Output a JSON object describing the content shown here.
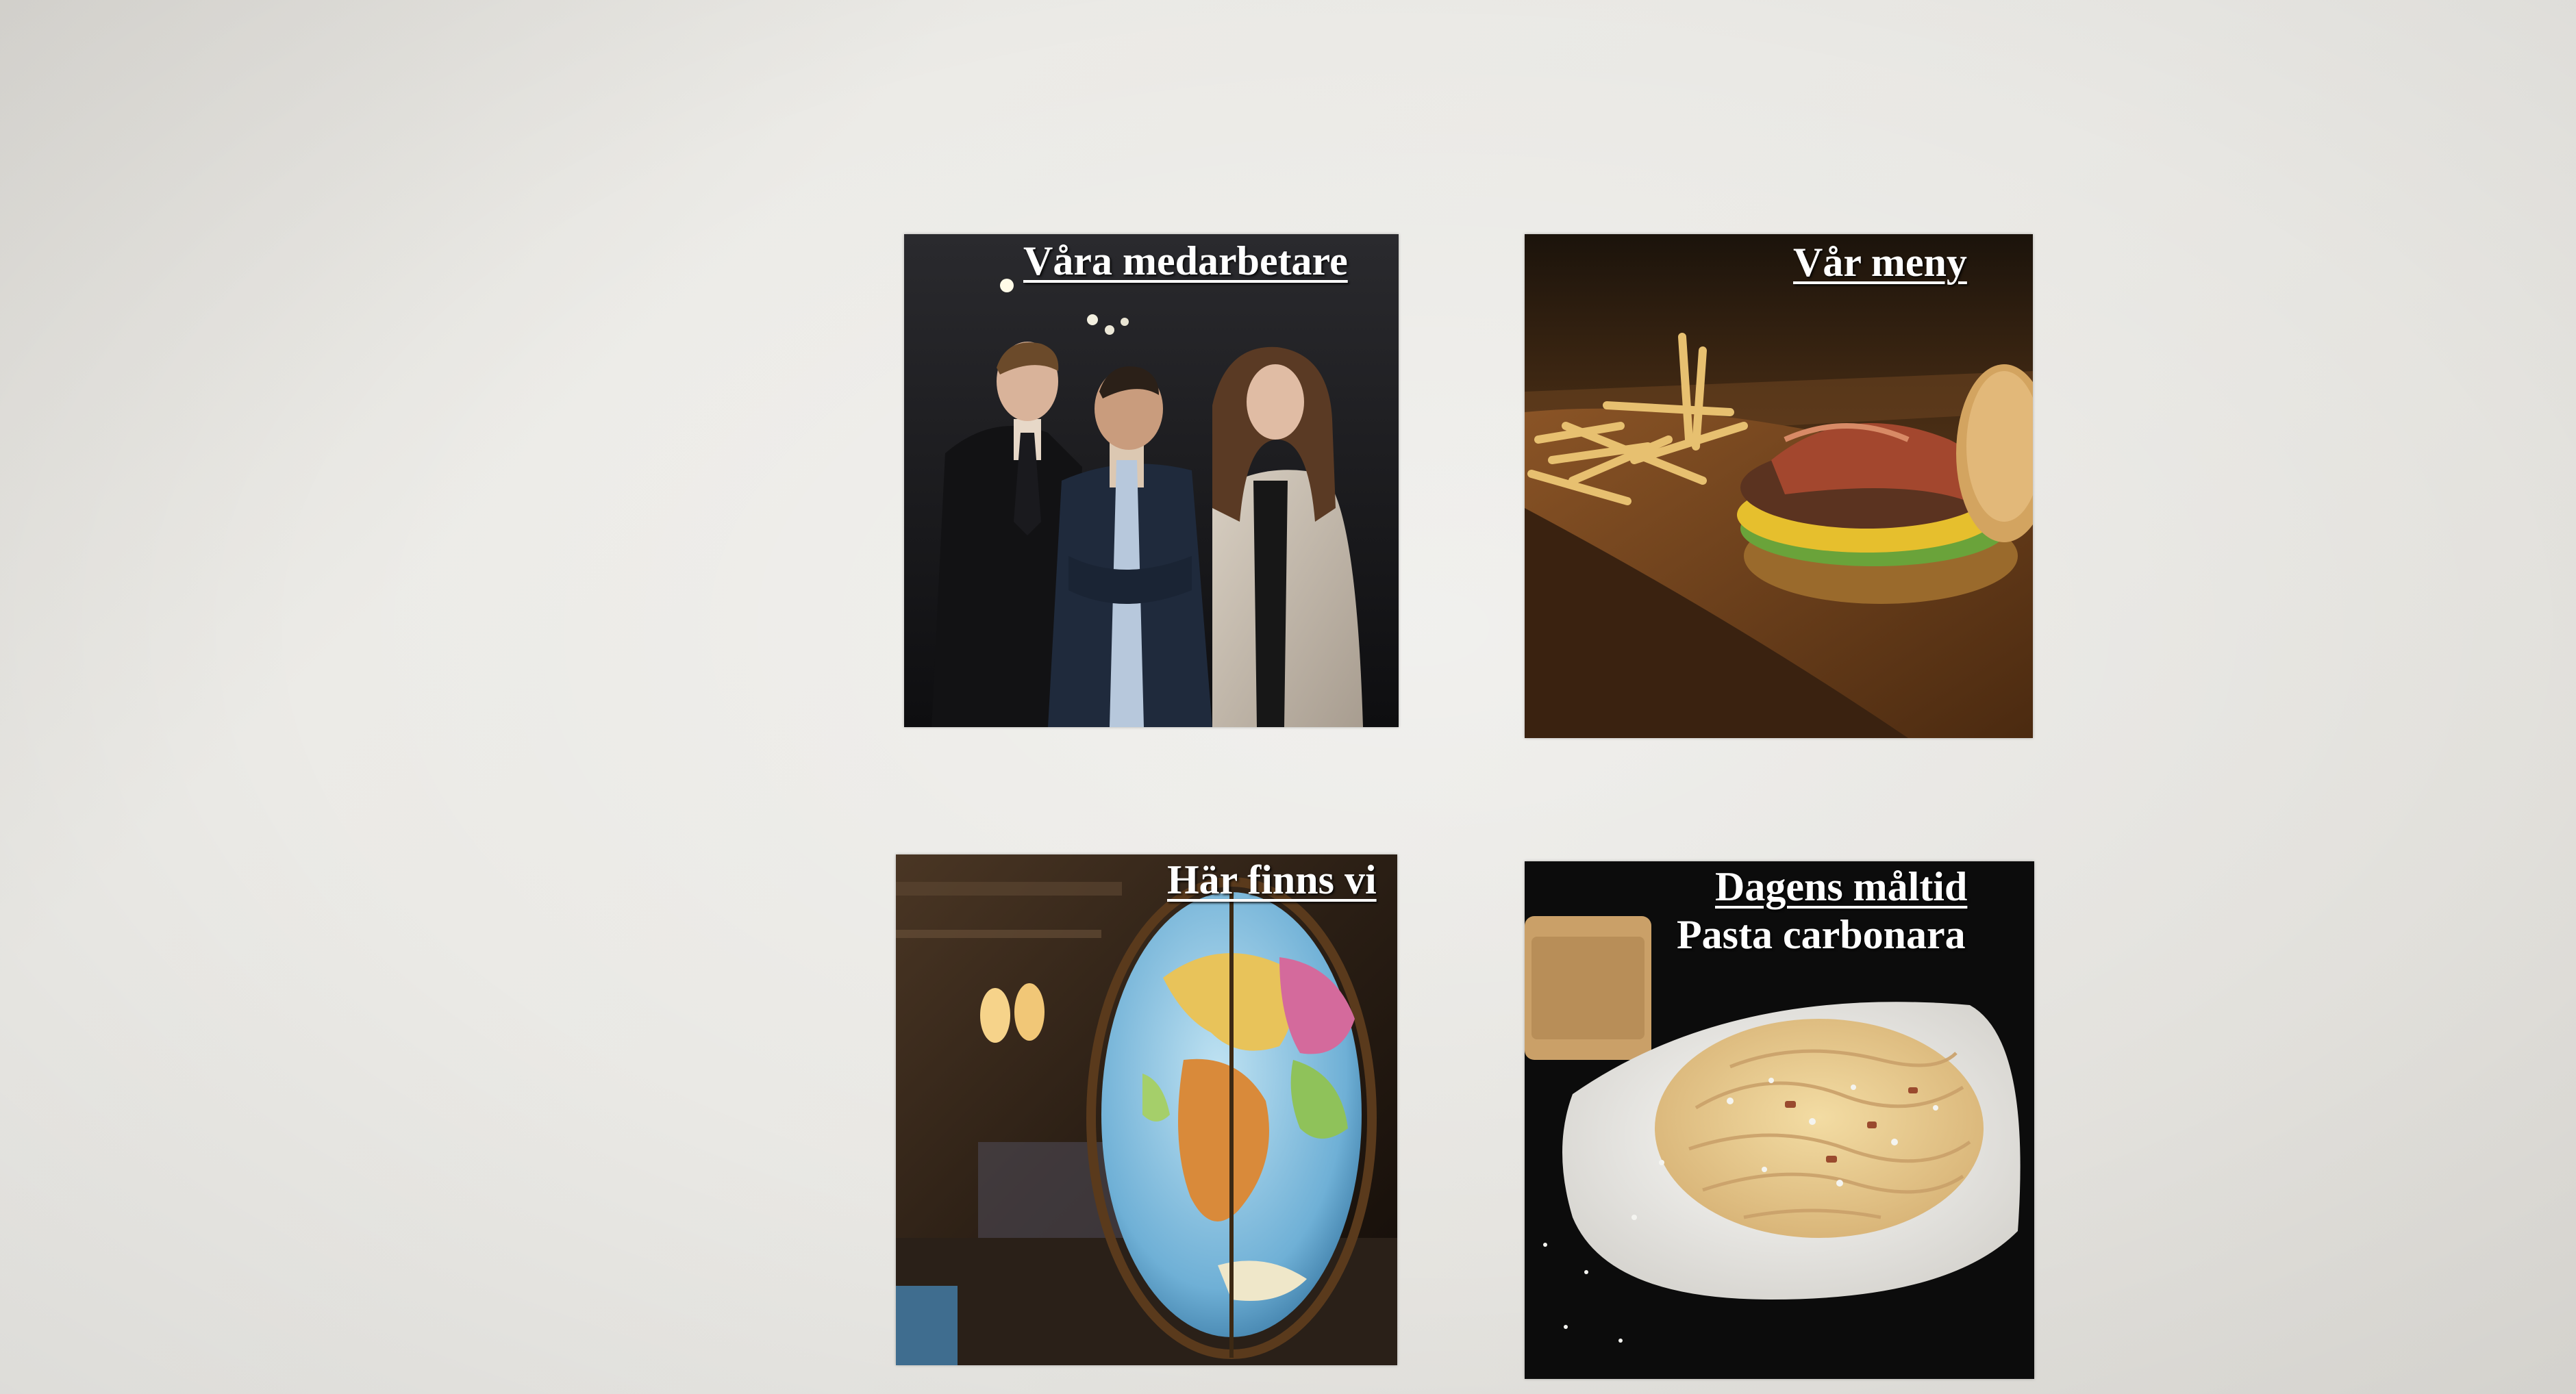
{
  "tiles": {
    "staff": {
      "link_label": "Våra medarbetare",
      "image": "staff-photo"
    },
    "menu": {
      "link_label": "Vår meny",
      "image": "burger-and-fries-photo"
    },
    "location": {
      "link_label": "Här finns vi",
      "image": "globe-photo"
    },
    "daily": {
      "link_label": "Dagens måltid",
      "dish": "Pasta carbonara",
      "image": "pasta-carbonara-photo"
    }
  },
  "colors": {
    "page_background": "#e9e8e4",
    "label_text": "#ffffff"
  }
}
